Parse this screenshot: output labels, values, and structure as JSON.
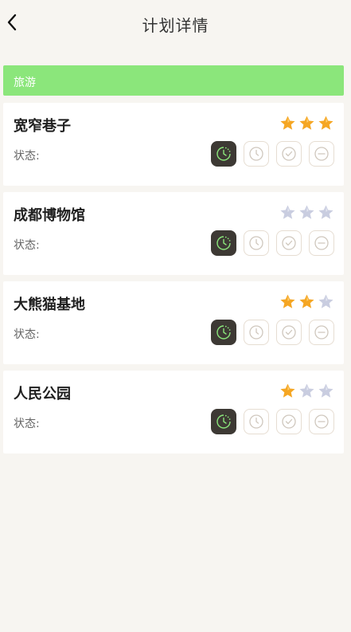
{
  "header": {
    "title": "计划详情",
    "back_icon": "chevron-left-icon"
  },
  "category": {
    "label": "旅游",
    "color": "#8be67b"
  },
  "status_label": "状态:",
  "status_options": [
    {
      "name": "in-progress",
      "icon": "clock-dotted-icon"
    },
    {
      "name": "pending",
      "icon": "clock-icon"
    },
    {
      "name": "done",
      "icon": "check-circle-icon"
    },
    {
      "name": "cancelled",
      "icon": "minus-circle-icon"
    }
  ],
  "plans": [
    {
      "name": "宽窄巷子",
      "rating": 3,
      "max_rating": 3,
      "status": "in-progress"
    },
    {
      "name": "成都博物馆",
      "rating": 0,
      "max_rating": 3,
      "status": "in-progress"
    },
    {
      "name": "大熊猫基地",
      "rating": 2,
      "max_rating": 3,
      "status": "in-progress"
    },
    {
      "name": "人民公园",
      "rating": 1,
      "max_rating": 3,
      "status": "in-progress"
    }
  ],
  "colors": {
    "background": "#f7f5f1",
    "star_filled": "#f5a623",
    "star_empty": "#c9cde0",
    "active_status": "#3d3934",
    "active_icon": "#8be67b"
  }
}
